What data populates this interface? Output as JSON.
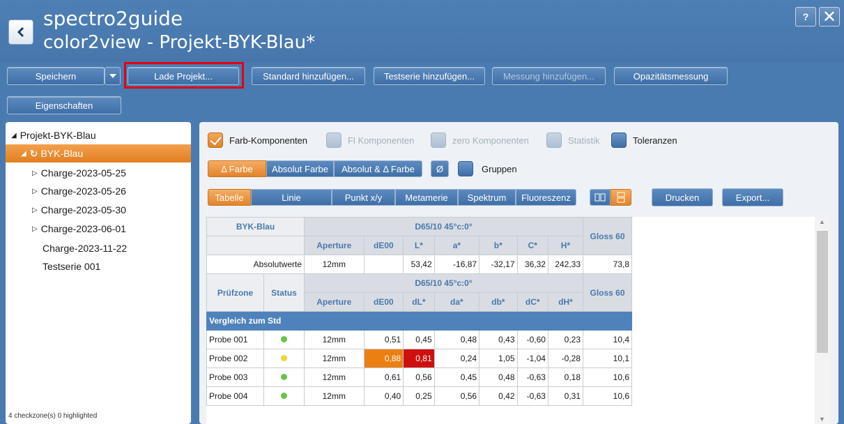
{
  "app": {
    "title": "spectro2guide",
    "subtitle": "color2view - Projekt-BYK-Blau*",
    "help": "?",
    "close": "✕"
  },
  "toolbar": {
    "save": "Speichern",
    "load_project": "Lade Projekt...",
    "add_standard": "Standard hinzufügen...",
    "add_testseries": "Testserie hinzufügen...",
    "add_measurement": "Messung hinzufügen...",
    "opacity": "Opazitätsmessung",
    "properties": "Eigenschaften"
  },
  "tree": {
    "root": "Projekt-BYK-Blau",
    "standard": "BYK-Blau",
    "items": [
      {
        "label": "Charge-2023-05-25",
        "expandable": true
      },
      {
        "label": "Charge-2023-05-26",
        "expandable": true
      },
      {
        "label": "Charge-2023-05-30",
        "expandable": true
      },
      {
        "label": "Charge-2023-06-01",
        "expandable": true
      },
      {
        "label": "Charge-2023-11-22",
        "expandable": false
      },
      {
        "label": "Testserie 001",
        "expandable": false
      }
    ],
    "status": "4 checkzone(s) 0 highlighted"
  },
  "options": {
    "farb": "Farb-Komponenten",
    "fl": "Fl Komponenten",
    "zero": "zero Komponenten",
    "statistik": "Statistik",
    "toleranzen": "Toleranzen",
    "gruppen": "Gruppen"
  },
  "mode_tabs": {
    "delta": "Δ Farbe",
    "absolut": "Absolut Farbe",
    "abs_delta": "Absolut & Δ Farbe",
    "avg": "Ø"
  },
  "view_tabs": {
    "tabelle": "Tabelle",
    "linie": "Linie",
    "punkt": "Punkt x/y",
    "metamerie": "Metamerie",
    "spektrum": "Spektrum",
    "fluoreszenz": "Fluoreszenz",
    "print": "Drucken",
    "export": "Export..."
  },
  "table": {
    "std_name": "BYK-Blau",
    "geometry": "D65/10  45°c:0°",
    "gloss": "Gloss 60",
    "abs_headers": [
      "Aperture",
      "dE00",
      "L*",
      "a*",
      "b*",
      "C*",
      "H*"
    ],
    "abs_row": {
      "label": "Absolutwerte",
      "aperture": "12mm",
      "de": "",
      "L": "53,42",
      "a": "-16,87",
      "b": "-32,17",
      "C": "36,32",
      "H": "242,33",
      "gloss": "73,8"
    },
    "zone_header": "Prüfzone",
    "status_header": "Status",
    "delta_headers": [
      "Aperture",
      "dE00",
      "dL*",
      "da*",
      "db*",
      "dC*",
      "dH*"
    ],
    "section": "Vergleich zum Std",
    "rows": [
      {
        "name": "Probe 001",
        "status": "#6cc24a",
        "aperture": "12mm",
        "de": "0,51",
        "dL": "0,45",
        "da": "0,48",
        "db": "0,43",
        "dC": "-0,60",
        "dH": "0,23",
        "gloss": "10,4"
      },
      {
        "name": "Probe 002",
        "status": "#f2d43a",
        "aperture": "12mm",
        "de": "0,88",
        "dL": "0,81",
        "da": "0,24",
        "db": "1,05",
        "dC": "-1,04",
        "dH": "-0,28",
        "gloss": "10,1"
      },
      {
        "name": "Probe 003",
        "status": "#6cc24a",
        "aperture": "12mm",
        "de": "0,61",
        "dL": "0,56",
        "da": "0,45",
        "db": "0,48",
        "dC": "-0,63",
        "dH": "0,18",
        "gloss": "10,6"
      },
      {
        "name": "Probe 004",
        "status": "#6cc24a",
        "aperture": "12mm",
        "de": "0,40",
        "dL": "0,25",
        "da": "0,56",
        "db": "0,42",
        "dC": "-0,63",
        "dH": "0,31",
        "gloss": "10,6"
      }
    ]
  },
  "colors": {
    "accent": "#e3832a",
    "brand_blue": "#4a7bb0",
    "highlight_red": "#e3000f"
  }
}
